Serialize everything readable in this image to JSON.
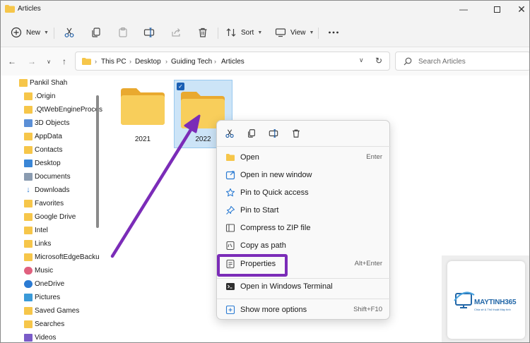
{
  "window": {
    "title": "Articles",
    "controls": [
      "minimize",
      "maximize",
      "close"
    ]
  },
  "toolbar": {
    "new_label": "New",
    "sort_label": "Sort",
    "view_label": "View",
    "icons": [
      "cut-icon",
      "copy-icon",
      "paste-icon",
      "rename-icon",
      "share-icon",
      "delete-icon",
      "more-icon"
    ]
  },
  "address": {
    "breadcrumbs": [
      "This PC",
      "Desktop",
      "Guiding Tech",
      "Articles"
    ],
    "search_placeholder": "Search Articles"
  },
  "sidebar": {
    "items": [
      {
        "label": "Pankil Shah",
        "icon": "folder-icon"
      },
      {
        "label": ".Origin",
        "icon": "folder-icon"
      },
      {
        "label": ".QtWebEngineProces",
        "icon": "folder-icon"
      },
      {
        "label": "3D Objects",
        "icon": "cube-icon"
      },
      {
        "label": "AppData",
        "icon": "folder-icon"
      },
      {
        "label": "Contacts",
        "icon": "folder-icon"
      },
      {
        "label": "Desktop",
        "icon": "desktop-icon"
      },
      {
        "label": "Documents",
        "icon": "documents-icon"
      },
      {
        "label": "Downloads",
        "icon": "download-icon"
      },
      {
        "label": "Favorites",
        "icon": "folder-icon"
      },
      {
        "label": "Google Drive",
        "icon": "folder-icon"
      },
      {
        "label": "Intel",
        "icon": "folder-icon"
      },
      {
        "label": "Links",
        "icon": "folder-icon"
      },
      {
        "label": "MicrosoftEdgeBacku",
        "icon": "folder-icon"
      },
      {
        "label": "Music",
        "icon": "music-icon"
      },
      {
        "label": "OneDrive",
        "icon": "onedrive-icon"
      },
      {
        "label": "Pictures",
        "icon": "pictures-icon"
      },
      {
        "label": "Saved Games",
        "icon": "folder-icon"
      },
      {
        "label": "Searches",
        "icon": "folder-icon"
      },
      {
        "label": "Videos",
        "icon": "videos-icon"
      }
    ]
  },
  "folders": [
    {
      "name": "2021",
      "selected": false
    },
    {
      "name": "2022",
      "selected": true
    }
  ],
  "context_menu": {
    "top_icons": [
      "cut-icon",
      "copy-icon",
      "rename-icon",
      "delete-icon"
    ],
    "items": [
      {
        "label": "Open",
        "shortcut": "Enter",
        "icon": "folder-open-icon"
      },
      {
        "label": "Open in new window",
        "shortcut": "",
        "icon": "new-window-icon"
      },
      {
        "label": "Pin to Quick access",
        "shortcut": "",
        "icon": "star-icon"
      },
      {
        "label": "Pin to Start",
        "shortcut": "",
        "icon": "pin-icon"
      },
      {
        "label": "Compress to ZIP file",
        "shortcut": "",
        "icon": "zip-icon"
      },
      {
        "label": "Copy as path",
        "shortcut": "",
        "icon": "copy-path-icon"
      },
      {
        "label": "Properties",
        "shortcut": "Alt+Enter",
        "icon": "properties-icon"
      },
      {
        "label": "Open in Windows Terminal",
        "shortcut": "",
        "icon": "terminal-icon"
      },
      {
        "label": "Show more options",
        "shortcut": "Shift+F10",
        "icon": "more-options-icon"
      }
    ]
  },
  "watermark": {
    "brand": "MAYTINH365",
    "tagline": "Chia sẻ & Thủ thuật Máy tính"
  },
  "colors": {
    "accent": "#1a5fb4",
    "highlight": "#7b2cb8",
    "folder": "#f6c64a",
    "selection": "#cce4f7"
  }
}
